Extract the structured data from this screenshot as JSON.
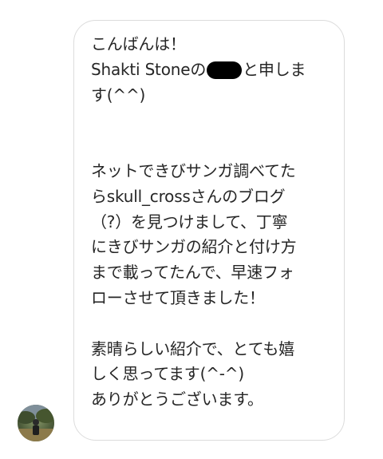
{
  "message": {
    "line1": "こんばんは！",
    "line2_prefix": "Shakti Stoneの",
    "line2_suffix": "と申しま",
    "line3": "す(^^)",
    "line4": "ネットできびサンガ調べてた",
    "line5": "らskull_crossさんのブログ",
    "line6": "（?）を見つけまして、丁寧",
    "line7": "にきびサンガの紹介と付け方",
    "line8": "まで載ってたんで、早速フォ",
    "line9": "ローさせて頂きました！",
    "line10": "素晴らしい紹介で、とても嬉",
    "line11": "しく思ってます(^-^)",
    "line12": "ありがとうございます。"
  },
  "icons": {
    "avatar": "profile-photo"
  }
}
